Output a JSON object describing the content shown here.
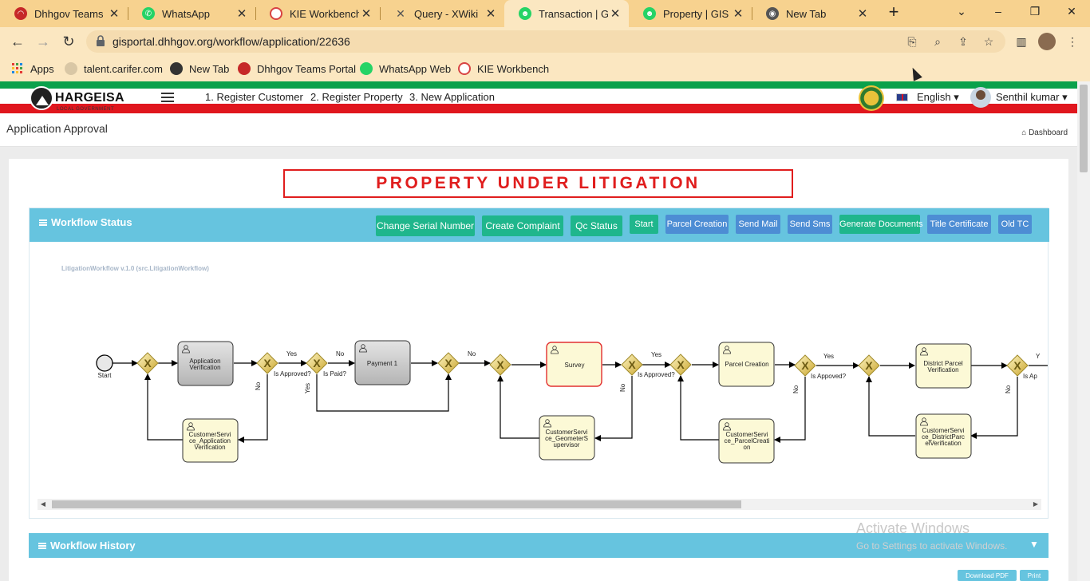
{
  "browser": {
    "tabs": [
      {
        "title": "Dhhgov Teams Po",
        "color": "#c62828"
      },
      {
        "title": "WhatsApp",
        "color": "#25d366"
      },
      {
        "title": "KIE Workbench",
        "color": "#d84343"
      },
      {
        "title": "Query - XWiki",
        "color": "#555555"
      },
      {
        "title": "Transaction | GIS",
        "color": "#25d366"
      },
      {
        "title": "Property | GIS Po",
        "color": "#25d366"
      },
      {
        "title": "New Tab",
        "color": "#555555"
      }
    ],
    "active_tab_index": 4,
    "url": "gisportal.dhhgov.org/workflow/application/22636",
    "bookmarks": [
      {
        "label": "Apps",
        "icon": "apps-grid-icon"
      },
      {
        "label": "talent.carifer.com",
        "icon": "site-icon"
      },
      {
        "label": "New Tab",
        "icon": "globe-icon"
      },
      {
        "label": "Dhhgov Teams Portal",
        "icon": "teams-icon"
      },
      {
        "label": "WhatsApp Web",
        "icon": "whatsapp-icon"
      },
      {
        "label": "KIE Workbench",
        "icon": "kie-icon"
      }
    ]
  },
  "header": {
    "logo_text": "HARGEISA",
    "logo_sub": "LOCAL GOVERNMENT",
    "nav": [
      "1. Register Customer",
      "2. Register Property",
      "3. New Application"
    ],
    "language": "English",
    "user": "Senthil kumar"
  },
  "page": {
    "title": "Application Approval",
    "breadcrumb": "Dashboard",
    "banner": "PROPERTY UNDER LITIGATION"
  },
  "workflow_panel": {
    "title": "Workflow Status",
    "buttons": [
      {
        "label": "Change Serial Number",
        "color": "green"
      },
      {
        "label": "Create Complaint",
        "color": "green"
      },
      {
        "label": "Qc Status",
        "color": "green"
      },
      {
        "label": "Start",
        "color": "green"
      },
      {
        "label": "Parcel Creation",
        "color": "blue"
      },
      {
        "label": "Send Mail",
        "color": "blue"
      },
      {
        "label": "Send Sms",
        "color": "blue"
      },
      {
        "label": "Generate Documents",
        "color": "green"
      },
      {
        "label": "Title Certificate",
        "color": "blue"
      },
      {
        "label": "Old TC",
        "color": "blue"
      }
    ]
  },
  "diagram": {
    "caption": "LitigationWorkflow v.1.0 (src.LitigationWorkflow)",
    "start_label": "Start",
    "tasks": {
      "app_verification": [
        "Application",
        "Verification"
      ],
      "cs_app_verification": [
        "CustomerServi",
        "ce_Application",
        "Verification"
      ],
      "payment": [
        "Payment 1"
      ],
      "survey": [
        "Survey"
      ],
      "cs_geometer": [
        "CustomerServi",
        "ce_GeometerS",
        "upervisor"
      ],
      "parcel_creation": [
        "Parcel Creation"
      ],
      "cs_parcel": [
        "CustomerServi",
        "ce_ParcelCreati",
        "on"
      ],
      "district_parcel": [
        "District Parcel",
        "Verification"
      ],
      "cs_district": [
        "CustomerServi",
        "ce_DistrictParc",
        "elVerification"
      ]
    },
    "labels": {
      "is_approved": "Is Approved?",
      "is_paid": "Is Paid?",
      "is_appoved": "Is Appoved?",
      "is_ap": "Is Ap",
      "yes": "Yes",
      "no": "No",
      "y": "Y"
    }
  },
  "history_panel": {
    "title": "Workflow History"
  },
  "watermark": {
    "line1": "Activate Windows",
    "line2": "Go to Settings to activate Windows."
  },
  "bottom_buttons": [
    "Download PDF",
    "Print"
  ]
}
